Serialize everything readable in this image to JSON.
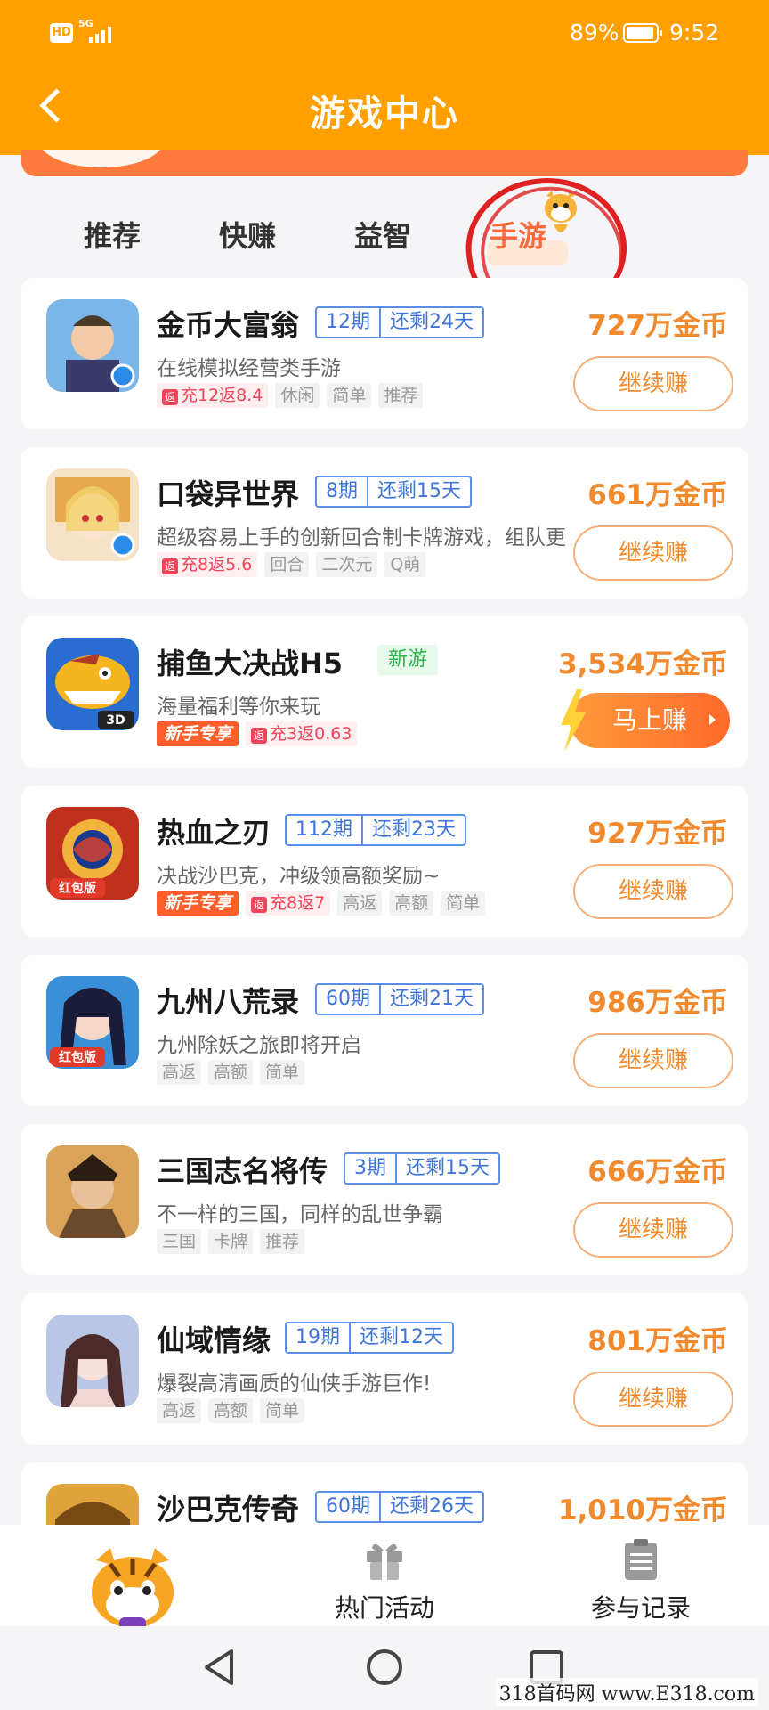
{
  "status_bar": {
    "hd_label": "HD",
    "signal_label": "5G",
    "battery_pct": "89%",
    "time": "9:52"
  },
  "header": {
    "title": "游戏中心",
    "back_icon": "chevron-left-icon"
  },
  "tabs": [
    {
      "label": "推荐",
      "active": false
    },
    {
      "label": "快赚",
      "active": false
    },
    {
      "label": "益智",
      "active": false
    },
    {
      "label": "手游",
      "active": true
    }
  ],
  "games": [
    {
      "name": "金币大富翁",
      "period": "12期",
      "remaining": "还剩24天",
      "desc": "在线模拟经营类手游",
      "recharge": "充12返8.4",
      "tags": [
        "休闲",
        "简单",
        "推荐"
      ],
      "coins": "727万金币",
      "button": "继续赚",
      "icon_colors": [
        "#7ab6e8",
        "#f3c9a6"
      ]
    },
    {
      "name": "口袋异世界",
      "period": "8期",
      "remaining": "还剩15天",
      "desc": "超级容易上手的创新回合制卡牌游戏，组队更",
      "recharge": "充8返5.6",
      "tags": [
        "回合",
        "二次元",
        "Q萌"
      ],
      "coins": "661万金币",
      "button": "继续赚",
      "icon_colors": [
        "#e8a94d",
        "#f6e3c7"
      ]
    },
    {
      "name": "捕鱼大决战H5",
      "new_tag": "新游",
      "desc": "海量福利等你来玩",
      "newbie": "新手专享",
      "recharge": "充3返0.63",
      "tags": [],
      "coins": "3,534万金币",
      "button": "马上赚",
      "badge_3d": "3D",
      "icon_colors": [
        "#f4b51e",
        "#2a6dd0"
      ]
    },
    {
      "name": "热血之刃",
      "period": "112期",
      "remaining": "还剩23天",
      "desc": "决战沙巴克，冲级领高额奖励~",
      "newbie": "新手专享",
      "recharge": "充8返7",
      "tags": [
        "高返",
        "高额",
        "简单"
      ],
      "coins": "927万金币",
      "button": "继续赚",
      "icon_badge": "红包版",
      "icon_colors": [
        "#c0301e",
        "#f2b33c"
      ]
    },
    {
      "name": "九州八荒录",
      "period": "60期",
      "remaining": "还剩21天",
      "desc": "九州除妖之旅即将开启",
      "tags": [
        "高返",
        "高额",
        "简单"
      ],
      "coins": "986万金币",
      "button": "继续赚",
      "icon_badge": "红包版",
      "icon_colors": [
        "#3b8fd6",
        "#d7e8f6"
      ]
    },
    {
      "name": "三国志名将传",
      "period": "3期",
      "remaining": "还剩15天",
      "desc": "不一样的三国，同样的乱世争霸",
      "tags": [
        "三国",
        "卡牌",
        "推荐"
      ],
      "coins": "666万金币",
      "button": "继续赚",
      "icon_colors": [
        "#6b4a2b",
        "#d9a45a"
      ]
    },
    {
      "name": "仙域情缘",
      "period": "19期",
      "remaining": "还剩12天",
      "desc": "爆裂高清画质的仙侠手游巨作!",
      "tags": [
        "高返",
        "高额",
        "简单"
      ],
      "coins": "801万金币",
      "button": "继续赚",
      "icon_colors": [
        "#b9c6e6",
        "#f1d7d4"
      ]
    },
    {
      "name": "沙巴克传奇",
      "period": "60期",
      "remaining": "还剩26天",
      "coins": "1,010万金币",
      "icon_colors": [
        "#7a4a14",
        "#e0a23a"
      ]
    }
  ],
  "bottom_nav": {
    "hot_label": "热门活动",
    "record_label": "参与记录"
  },
  "watermark": "318首码网 www.E318.com",
  "colors": {
    "header_bg": "#ffa000",
    "accent": "#f08a2c",
    "period_blue": "#3f74d9",
    "new_green": "#2fb14d",
    "annotation_red": "#e02020"
  }
}
